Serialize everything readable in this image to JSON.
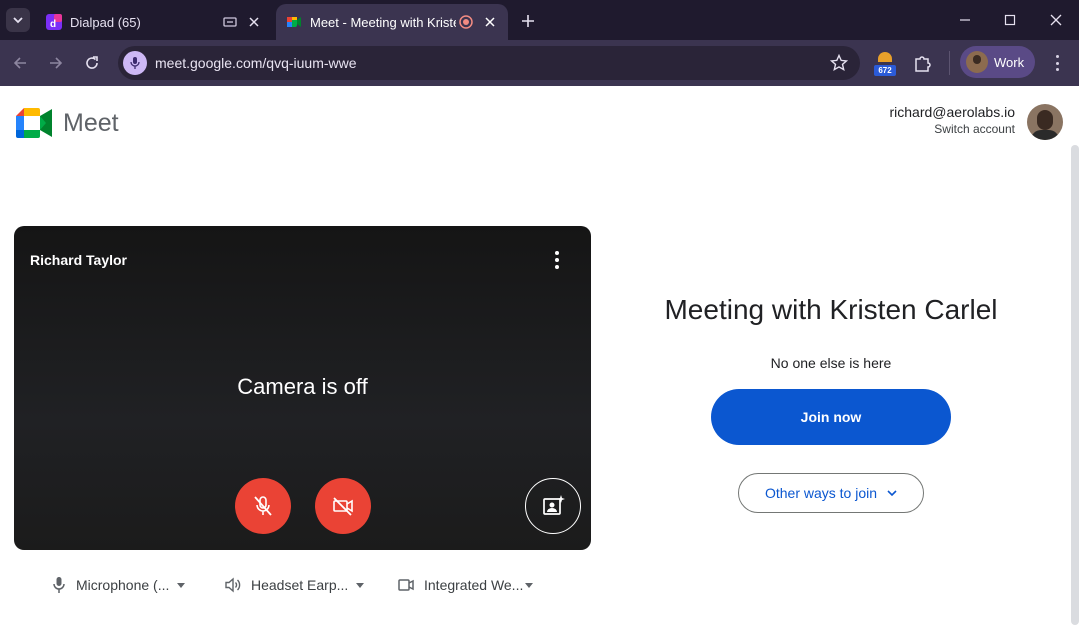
{
  "browser": {
    "tabs": [
      {
        "title": "Dialpad (65)",
        "favicon": "dialpad-icon",
        "active": false
      },
      {
        "title": "Meet - Meeting with Kristen Carlel",
        "favicon": "google-meet-icon",
        "active": true
      }
    ],
    "address": "meet.google.com/qvq-iuum-wwe",
    "extension_badge": "672",
    "profile_label": "Work"
  },
  "header": {
    "product_name": "Meet",
    "account_email": "richard@aerolabs.io",
    "switch_account_label": "Switch account"
  },
  "preview": {
    "participant_name": "Richard Taylor",
    "camera_status": "Camera is off",
    "mic_on": false,
    "camera_on": false
  },
  "devices": [
    {
      "icon": "microphone-icon",
      "label": "Microphone (..."
    },
    {
      "icon": "speaker-icon",
      "label": "Headset Earp..."
    },
    {
      "icon": "video-camera-icon",
      "label": "Integrated We..."
    }
  ],
  "join_panel": {
    "meeting_title": "Meeting with Kristen Carlel",
    "status": "No one else is here",
    "join_label": "Join now",
    "other_ways_label": "Other ways to join"
  },
  "colors": {
    "primary": "#0b57d0",
    "danger": "#ea4335",
    "chrome_dark": "#1f1a2e",
    "chrome_toolbar": "#3b3450"
  }
}
